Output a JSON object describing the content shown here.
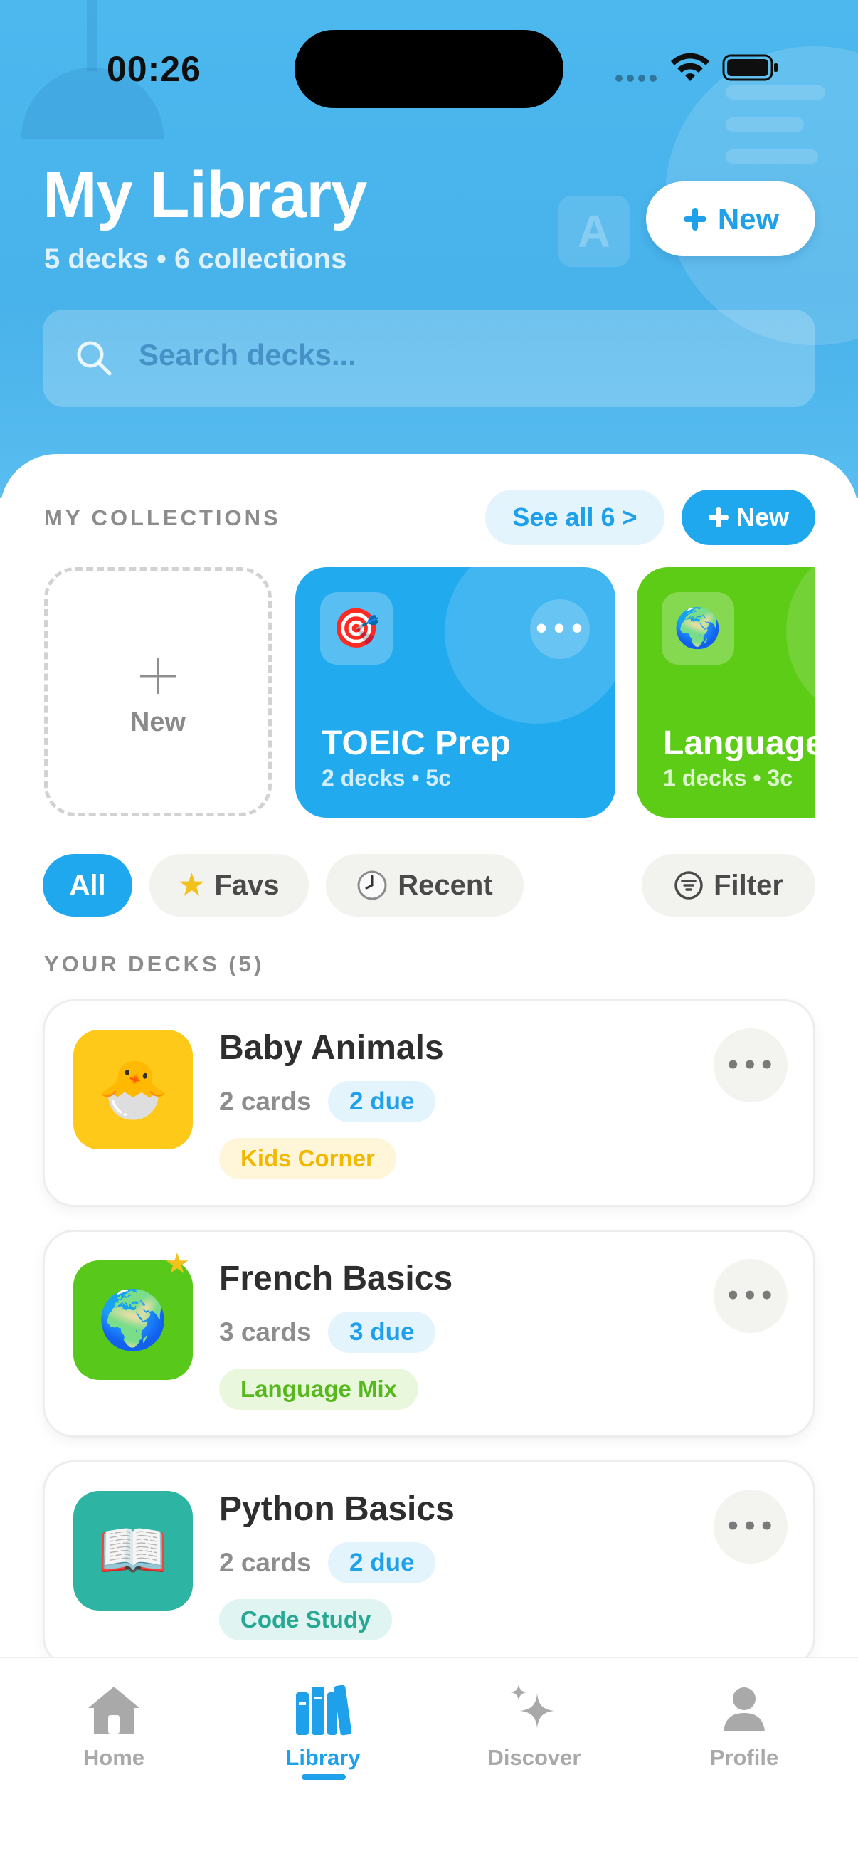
{
  "status_bar": {
    "time": "00:26"
  },
  "header": {
    "title": "My Library",
    "subtitle": "5 decks • 6 collections",
    "new_button": "New",
    "search_placeholder": "Search decks..."
  },
  "collections": {
    "section_label": "MY COLLECTIONS",
    "see_all": "See all 6 >",
    "new_button": "New",
    "new_card_label": "New",
    "items": [
      {
        "name": "TOEIC Prep",
        "meta": "2 decks • 5c",
        "emoji": "🎯",
        "color": "#22aaee"
      },
      {
        "name": "Language Mix",
        "meta": "1 decks • 3c",
        "emoji": "🌍",
        "color": "#5ccc16"
      }
    ]
  },
  "filters": {
    "all": "All",
    "favs": "Favs",
    "recent": "Recent",
    "filter": "Filter"
  },
  "decks": {
    "section_label": "YOUR DECKS (5)",
    "items": [
      {
        "name": "Baby Animals",
        "cards": "2 cards",
        "due": "2 due",
        "tag": "Kids Corner",
        "emoji": "🐣",
        "tile_color": "#ffc91a",
        "tag_bg": "#fff6d9",
        "tag_color": "#f2b800",
        "favorite": false
      },
      {
        "name": "French Basics",
        "cards": "3 cards",
        "due": "3 due",
        "tag": "Language Mix",
        "emoji": "🌍",
        "tile_color": "#58c81a",
        "tag_bg": "#e9f8dd",
        "tag_color": "#56b81c",
        "favorite": true
      },
      {
        "name": "Python Basics",
        "cards": "2 cards",
        "due": "2 due",
        "tag": "Code Study",
        "emoji": "📖",
        "tile_color": "#2db4a2",
        "tag_bg": "#e0f5f1",
        "tag_color": "#27a894",
        "favorite": false
      }
    ]
  },
  "tabbar": {
    "home": "Home",
    "library": "Library",
    "discover": "Discover",
    "profile": "Profile",
    "active": "library"
  },
  "colors": {
    "accent": "#1fa8ee",
    "header_bg": "#4cb8ee"
  }
}
